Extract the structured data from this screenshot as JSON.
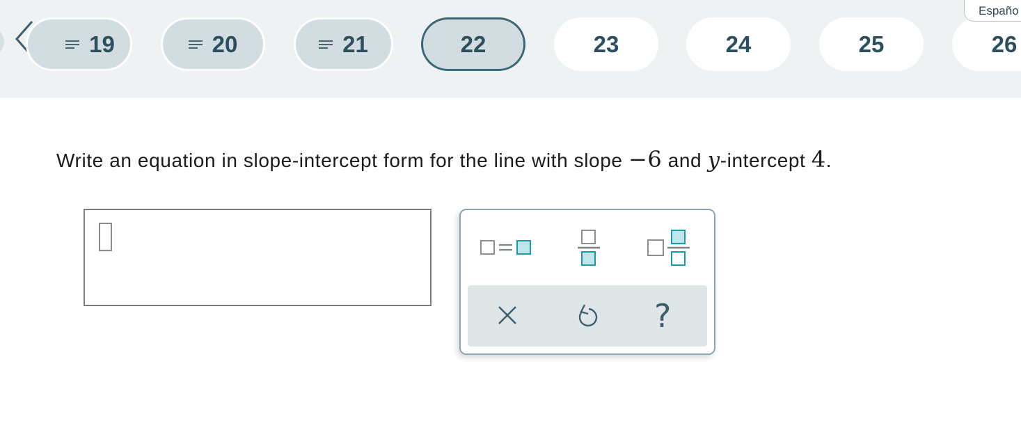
{
  "language_button": "Españo",
  "nav": {
    "prev_icon": "chevron-left-icon",
    "questions": [
      {
        "num": "19",
        "state": "answered"
      },
      {
        "num": "20",
        "state": "answered"
      },
      {
        "num": "21",
        "state": "answered"
      },
      {
        "num": "22",
        "state": "current"
      },
      {
        "num": "23",
        "state": "blank"
      },
      {
        "num": "24",
        "state": "blank"
      },
      {
        "num": "25",
        "state": "blank"
      },
      {
        "num": "26",
        "state": "blank"
      }
    ]
  },
  "question": {
    "prefix": "Write an equation in slope-intercept form for the line with slope ",
    "slope": "−6",
    "middle": " and ",
    "var": "y",
    "after_var": "-intercept ",
    "intercept": "4",
    "end": "."
  },
  "answer": {
    "value": ""
  },
  "palette": {
    "buttons": [
      "equation-template-icon",
      "fraction-template-icon",
      "mixed-number-template-icon",
      "clear-icon",
      "undo-icon",
      "help-icon"
    ],
    "clear_glyph": "×",
    "help_glyph": "?"
  },
  "colors": {
    "topbar": "#eef2f3",
    "pill_answered": "#d2dde1",
    "current_border": "#3b6675",
    "accent_teal": "#1b9aa8"
  }
}
